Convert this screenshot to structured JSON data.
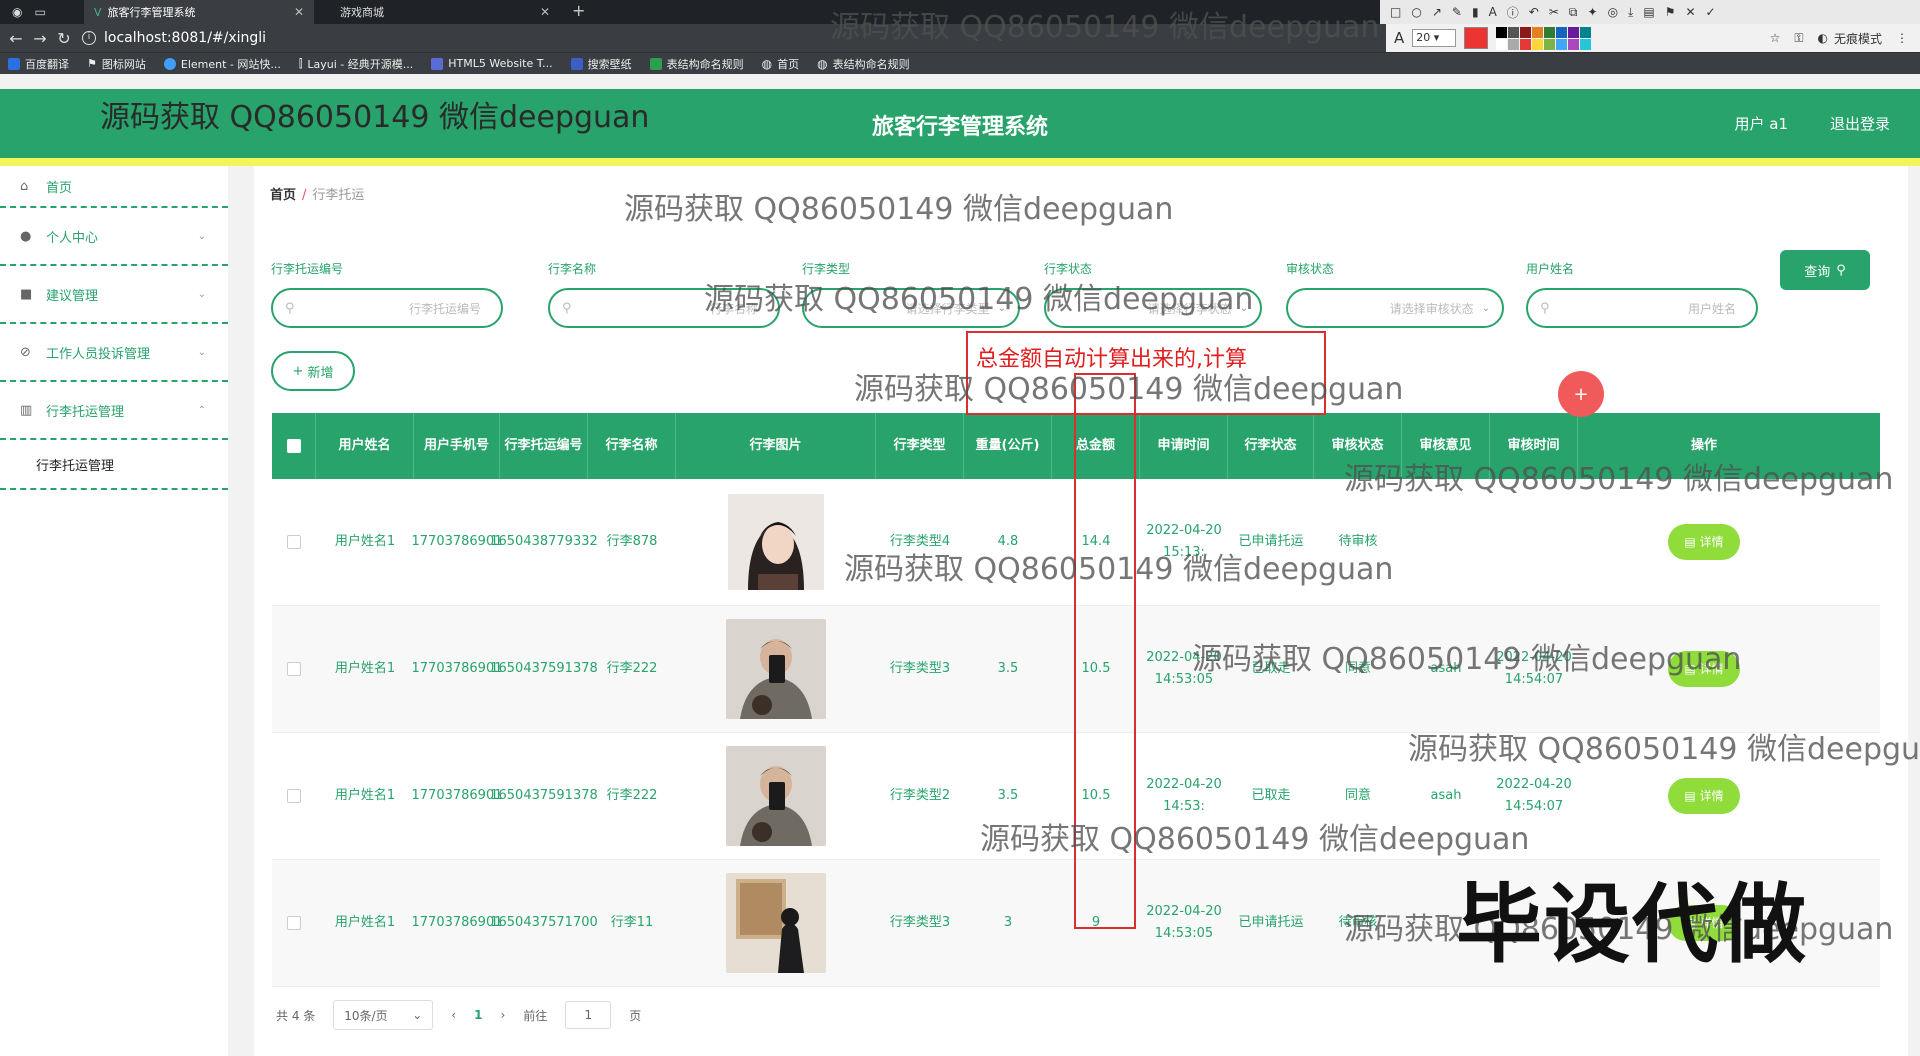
{
  "browser": {
    "tabs": [
      {
        "title": "旅客行李管理系统",
        "active": true
      },
      {
        "title": "游戏商城",
        "active": false
      }
    ],
    "url": "localhost:8081/#/xingli",
    "font_size": "20",
    "incognito": "无痕模式",
    "bookmarks": [
      "百度翻译",
      "图标网站",
      "Element - 网站快...",
      "Layui - 经典开源模...",
      "HTML5 Website T...",
      "搜索壁纸",
      "表结构命名规则",
      "首页",
      "表结构命名规则"
    ]
  },
  "header": {
    "title": "旅客行李管理系统",
    "user": "用户 a1",
    "logout": "退出登录"
  },
  "sidebar": {
    "items": [
      {
        "label": "首页",
        "icon": "home-icon"
      },
      {
        "label": "个人中心",
        "icon": "user-icon"
      },
      {
        "label": "建议管理",
        "icon": "video-icon"
      },
      {
        "label": "工作人员投诉管理",
        "icon": "compass-icon"
      },
      {
        "label": "行李托运管理",
        "icon": "chart-icon"
      }
    ],
    "sub_item": "行李托运管理"
  },
  "breadcrumb": {
    "home": "首页",
    "sep": "/",
    "current": "行李托运"
  },
  "filters": [
    {
      "label": "行李托运编号",
      "placeholder": "行李托运编号",
      "type": "text"
    },
    {
      "label": "行李名称",
      "placeholder": "行李名称",
      "type": "text"
    },
    {
      "label": "行李类型",
      "placeholder": "请选择行李类型",
      "type": "select"
    },
    {
      "label": "行李状态",
      "placeholder": "请选择行李状态",
      "type": "select"
    },
    {
      "label": "审核状态",
      "placeholder": "请选择审核状态",
      "type": "select"
    },
    {
      "label": "用户姓名",
      "placeholder": "用户姓名",
      "type": "text"
    }
  ],
  "buttons": {
    "query": "查询",
    "add": "新增",
    "detail": "详情"
  },
  "note": "总金额自动计算出来的,计算",
  "table": {
    "headers": [
      "用户姓名",
      "用户手机号",
      "行李托运编号",
      "行李名称",
      "行李图片",
      "行李类型",
      "重量(公斤)",
      "总金额",
      "申请时间",
      "行李状态",
      "审核状态",
      "审核意见",
      "审核时间",
      "操作"
    ],
    "rows": [
      {
        "name": "用户姓名1",
        "phone": "17703786901",
        "code": "1650438779332",
        "lname": "行李878",
        "type": "行李类型4",
        "weight": "4.8",
        "total": "14.4",
        "apply": "2022-04-20 15:13:",
        "status": "已申请托运",
        "audit": "待审核",
        "opinion": "",
        "audit_time": ""
      },
      {
        "name": "用户姓名1",
        "phone": "17703786901",
        "code": "1650437591378",
        "lname": "行李222",
        "type": "行李类型3",
        "weight": "3.5",
        "total": "10.5",
        "apply": "2022-04-20 14:53:05",
        "status": "已取走",
        "audit": "同意",
        "opinion": "asah",
        "audit_time": "2022-04-20 14:54:07"
      },
      {
        "name": "用户姓名1",
        "phone": "17703786901",
        "code": "1650437591378",
        "lname": "行李222",
        "type": "行李类型2",
        "weight": "3.5",
        "total": "10.5",
        "apply": "2022-04-20 14:53:",
        "status": "已取走",
        "audit": "同意",
        "opinion": "asah",
        "audit_time": "2022-04-20 14:54:07"
      },
      {
        "name": "用户姓名1",
        "phone": "17703786901",
        "code": "1650437571700",
        "lname": "行李11",
        "type": "行李类型3",
        "weight": "3",
        "total": "9",
        "apply": "2022-04-20 14:53:05",
        "status": "已申请托运",
        "audit": "待审核",
        "opinion": "",
        "audit_time": ""
      }
    ]
  },
  "pager": {
    "total": "共 4 条",
    "size": "10条/页",
    "page": "1",
    "goto_label": "前往",
    "goto_value": "1",
    "page_unit": "页"
  },
  "watermark": "源码获取 QQ86050149 微信deepguan",
  "stamp": "毕设代做"
}
